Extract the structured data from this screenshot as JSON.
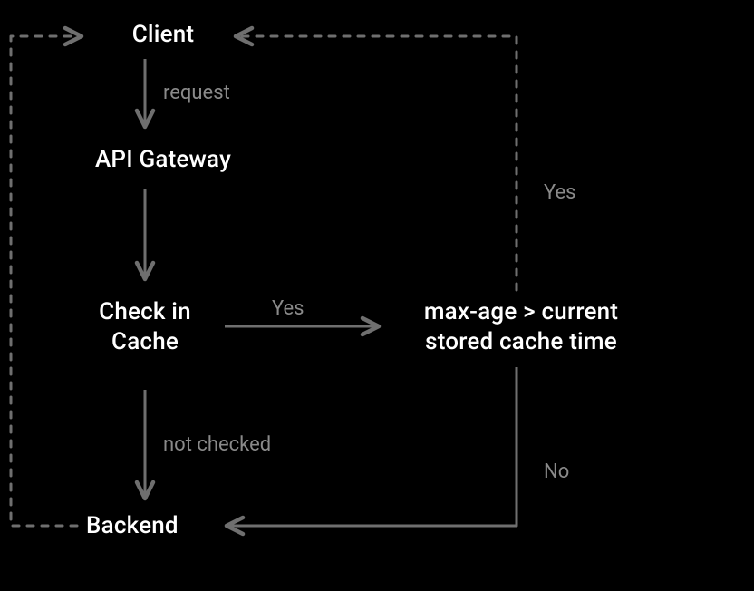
{
  "nodes": {
    "client": "Client",
    "api_gateway": "API Gateway",
    "check_cache_line1": "Check in",
    "check_cache_line2": "Cache",
    "maxage_line1": "max-age > current",
    "maxage_line2": "stored cache time",
    "backend": "Backend"
  },
  "edges": {
    "request": "request",
    "check_yes": "Yes",
    "not_checked": "not checked",
    "maxage_yes": "Yes",
    "maxage_no": "No"
  },
  "colors": {
    "bg": "#000000",
    "fg": "#ffffff",
    "muted": "#8a8a8a",
    "stroke": "#6f6f6f"
  }
}
